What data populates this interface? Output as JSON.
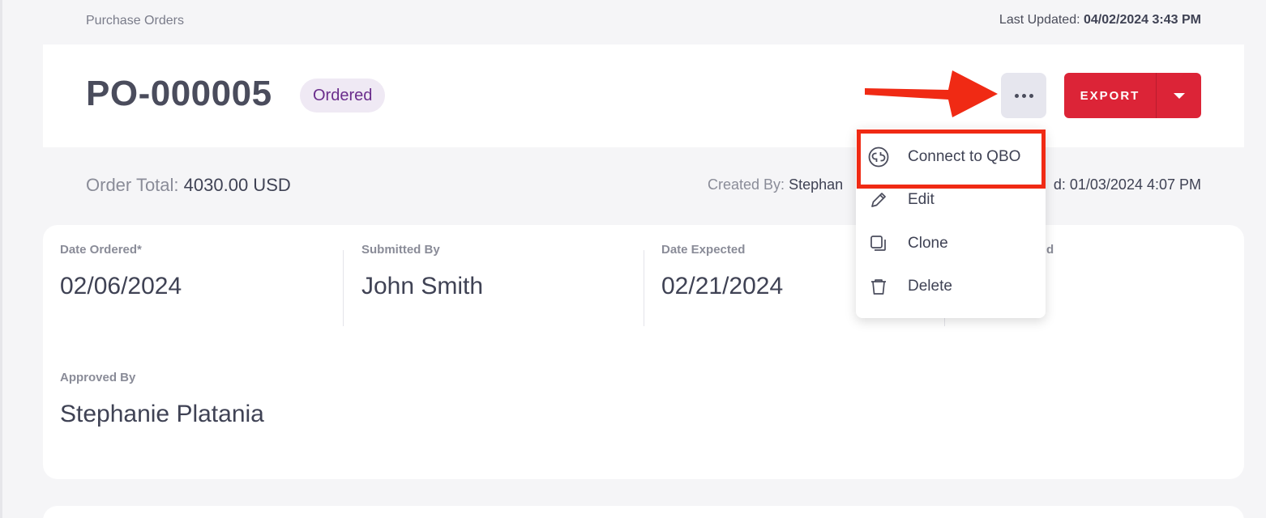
{
  "breadcrumb": "Purchase Orders",
  "last_updated": {
    "label": "Last Updated:",
    "value": "04/02/2024 3:43 PM"
  },
  "header": {
    "po_number": "PO-000005",
    "status": "Ordered",
    "more_icon": "more-horizontal-icon",
    "export_label": "EXPORT",
    "export_caret_icon": "caret-down-icon"
  },
  "summary": {
    "order_total_label": "Order Total:",
    "order_total_value": "4030.00 USD",
    "created_by_label": "Created By:",
    "created_by_value": "Stephan",
    "created_date_partial": "d: 01/03/2024 4:07 PM"
  },
  "details": {
    "date_ordered_label": "Date Ordered*",
    "date_ordered_value": "02/06/2024",
    "submitted_by_label": "Submitted By",
    "submitted_by_value": "John Smith",
    "date_expected_label": "Date Expected",
    "date_expected_value": "02/21/2024",
    "col4_label_partial": "d",
    "approved_by_label": "Approved By",
    "approved_by_value": "Stephanie Platania"
  },
  "menu": {
    "items": [
      {
        "label": "Connect to QBO",
        "icon": "quickbooks-icon"
      },
      {
        "label": "Edit",
        "icon": "pencil-icon"
      },
      {
        "label": "Clone",
        "icon": "copy-icon"
      },
      {
        "label": "Delete",
        "icon": "trash-icon"
      }
    ]
  },
  "colors": {
    "accent_red": "#dc2437",
    "status_bg": "#efe9f4",
    "status_text": "#6a2d8c",
    "annotation_red": "#f02a14"
  }
}
